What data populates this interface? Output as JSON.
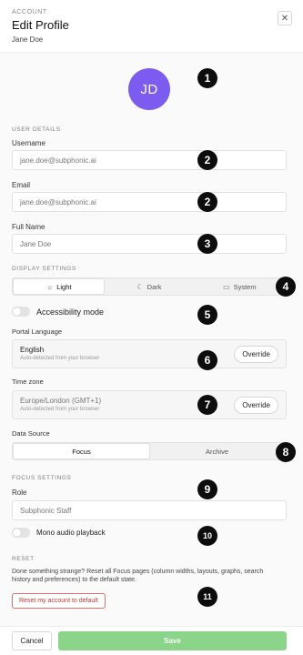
{
  "header": {
    "eyebrow": "ACCOUNT",
    "title": "Edit Profile",
    "subtitle": "Jane Doe",
    "close_symbol": "✕"
  },
  "avatar": {
    "initials": "JD",
    "color": "#7c5cf0"
  },
  "badges": [
    "1",
    "2",
    "2",
    "3",
    "4",
    "5",
    "6",
    "7",
    "8",
    "9",
    "10",
    "11"
  ],
  "user_details": {
    "section_label": "USER DETAILS",
    "username_label": "Username",
    "username_value": "jane.doe@subphonic.ai",
    "email_label": "Email",
    "email_value": "jane.doe@subphonic.ai",
    "fullname_label": "Full Name",
    "fullname_value": "Jane Doe"
  },
  "display_settings": {
    "section_label": "DISPLAY SETTINGS",
    "theme_options": [
      {
        "label": "Light",
        "icon": "sun-icon",
        "active": true
      },
      {
        "label": "Dark",
        "icon": "moon-icon",
        "active": false
      },
      {
        "label": "System",
        "icon": "monitor-icon",
        "active": false
      }
    ],
    "accessibility_label": "Accessibility mode",
    "portal_language_label": "Portal Language",
    "portal_language_value": "English",
    "portal_language_hint": "Auto-detected from your browser",
    "timezone_label": "Time zone",
    "timezone_value": "Europe/London (GMT+1)",
    "timezone_hint": "Auto-detected from your browser",
    "override_label": "Override",
    "data_source_label": "Data Source",
    "data_source_options": [
      {
        "label": "Focus",
        "active": true
      },
      {
        "label": "Archive",
        "active": false
      }
    ]
  },
  "focus_settings": {
    "section_label": "FOCUS SETTINGS",
    "role_label": "Role",
    "role_value": "Subphonic Staff",
    "mono_audio_label": "Mono audio playback"
  },
  "reset": {
    "section_label": "RESET",
    "description": "Done something strange? Reset all Focus pages (column widths, layouts, graphs, search history and preferences) to the default state.",
    "button_label": "Reset my account to default"
  },
  "footer": {
    "cancel_label": "Cancel",
    "save_label": "Save"
  },
  "colors": {
    "accent_avatar": "#7c5cf0",
    "save_button": "#8bd58b",
    "danger": "#c43a3a"
  }
}
